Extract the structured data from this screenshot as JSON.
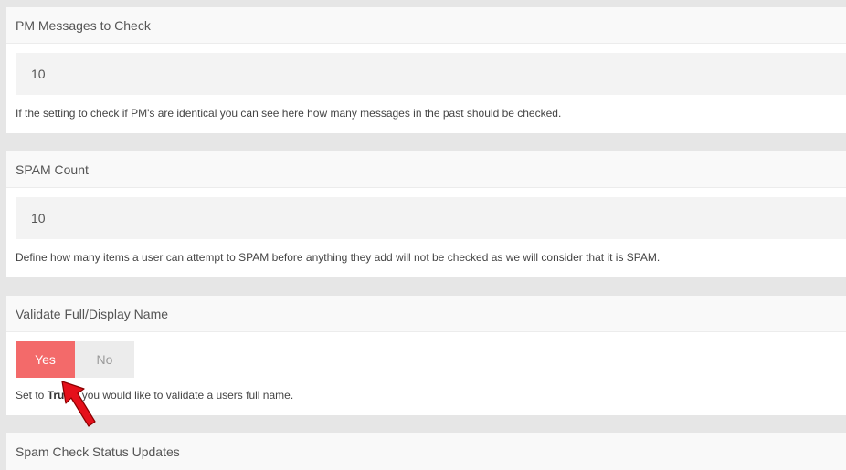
{
  "pm_messages": {
    "title": "PM Messages to Check",
    "value": "10",
    "help": "If the setting to check if PM's are identical you can see here how many messages in the past should be checked."
  },
  "spam_count": {
    "title": "SPAM Count",
    "value": "10",
    "help": "Define how many items a user can attempt to SPAM before anything they add will not be checked as we will consider that it is SPAM."
  },
  "validate_name": {
    "title": "Validate Full/Display Name",
    "yes_label": "Yes",
    "no_label": "No",
    "selected": "Yes",
    "help_prefix": "Set to ",
    "help_bold": "True",
    "help_suffix": " if you would like to validate a users full name."
  },
  "spam_check_status": {
    "title": "Spam Check Status Updates"
  },
  "colors": {
    "accent": "#f36a6a",
    "arrow": "#e5101b",
    "background": "#e6e6e6"
  }
}
